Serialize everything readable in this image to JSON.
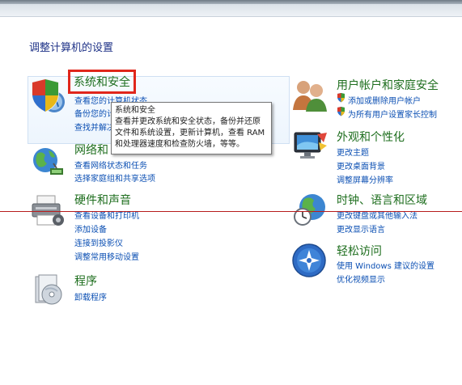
{
  "page": {
    "title": "调整计算机的设置"
  },
  "categories": {
    "system": {
      "title": "系统和安全",
      "links": [
        "查看您的计算机状态",
        "备份您的计算机",
        "查找并解决问题"
      ]
    },
    "network": {
      "title": "网络和 Internet",
      "links": [
        "查看网络状态和任务",
        "选择家庭组和共享选项"
      ]
    },
    "hardware": {
      "title": "硬件和声音",
      "links": [
        "查看设备和打印机",
        "添加设备",
        "连接到投影仪",
        "调整常用移动设置"
      ]
    },
    "programs": {
      "title": "程序",
      "links": [
        "卸载程序"
      ]
    },
    "users": {
      "title": "用户帐户和家庭安全",
      "links": [
        "添加或删除用户帐户",
        "为所有用户设置家长控制"
      ]
    },
    "appearance": {
      "title": "外观和个性化",
      "links": [
        "更改主题",
        "更改桌面背景",
        "调整屏幕分辨率"
      ]
    },
    "clock": {
      "title": "时钟、语言和区域",
      "links": [
        "更改键盘或其他输入法",
        "更改显示语言"
      ]
    },
    "ease": {
      "title": "轻松访问",
      "links": [
        "使用 Windows 建议的设置",
        "优化视频显示"
      ]
    }
  },
  "tooltip": {
    "title": "系统和安全",
    "body": "查看并更改系统和安全状态，备份并还原文件和系统设置，更新计算机，查看 RAM 和处理器速度和检查防火墙，等等。"
  },
  "colors": {
    "category_title": "#1e6e1e",
    "link": "#0b4fb3",
    "highlight_box": "#e0261b",
    "hover_panel": "#edf5fd"
  }
}
